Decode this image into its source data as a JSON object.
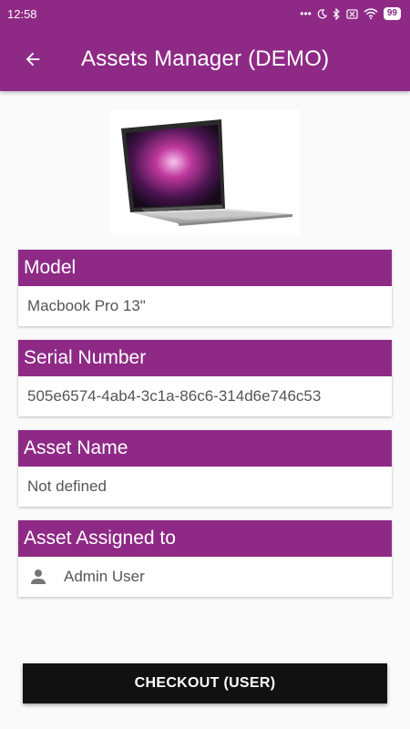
{
  "status_bar": {
    "time": "12:58",
    "dots": "•••",
    "battery": "99"
  },
  "app_bar": {
    "title": "Assets Manager (DEMO)"
  },
  "fields": [
    {
      "label": "Model",
      "value": "Macbook Pro 13\""
    },
    {
      "label": "Serial Number",
      "value": "505e6574-4ab4-3c1a-86c6-314d6e746c53"
    },
    {
      "label": "Asset Name",
      "value": "Not defined"
    },
    {
      "label": "Asset Assigned to",
      "value": "Admin User"
    }
  ],
  "checkout_button": {
    "label": "CHECKOUT (USER)"
  },
  "colors": {
    "primary": "#8e2a86",
    "button": "#111111"
  }
}
